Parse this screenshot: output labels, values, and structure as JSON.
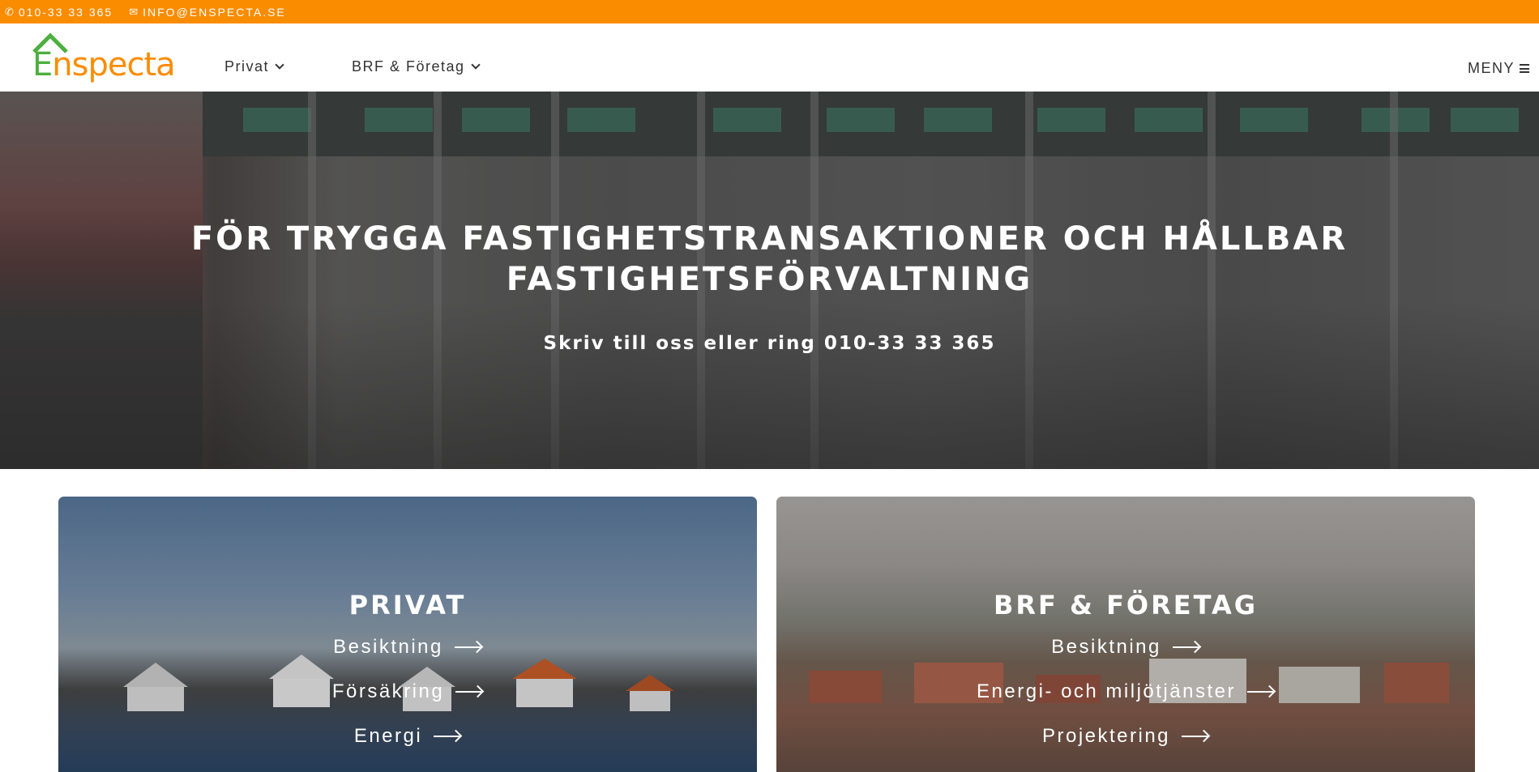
{
  "topbar": {
    "phone": "010-33 33 365",
    "phone_icon": "phone-icon",
    "email": "INFO@ENSPECTA.SE",
    "email_icon": "mail-icon"
  },
  "header": {
    "logo_first": "E",
    "logo_rest": "nspecta",
    "nav": [
      {
        "label": "Privat"
      },
      {
        "label": "BRF & Företag"
      }
    ],
    "menu_label": "MENY"
  },
  "hero": {
    "title": "FÖR TRYGGA FASTIGHETSTRANSAKTIONER OCH HÅLLBAR FASTIGHETSFÖRVALTNING",
    "subtitle": "Skriv till oss eller ring 010-33 33 365"
  },
  "cards": [
    {
      "title": "PRIVAT",
      "links": [
        "Besiktning",
        "Försäkring",
        "Energi"
      ]
    },
    {
      "title": "BRF & FÖRETAG",
      "links": [
        "Besiktning",
        "Energi- och miljötjänster",
        "Projektering"
      ]
    }
  ],
  "colors": {
    "accent_orange": "#fa8c00",
    "logo_green": "#4caf3e"
  }
}
